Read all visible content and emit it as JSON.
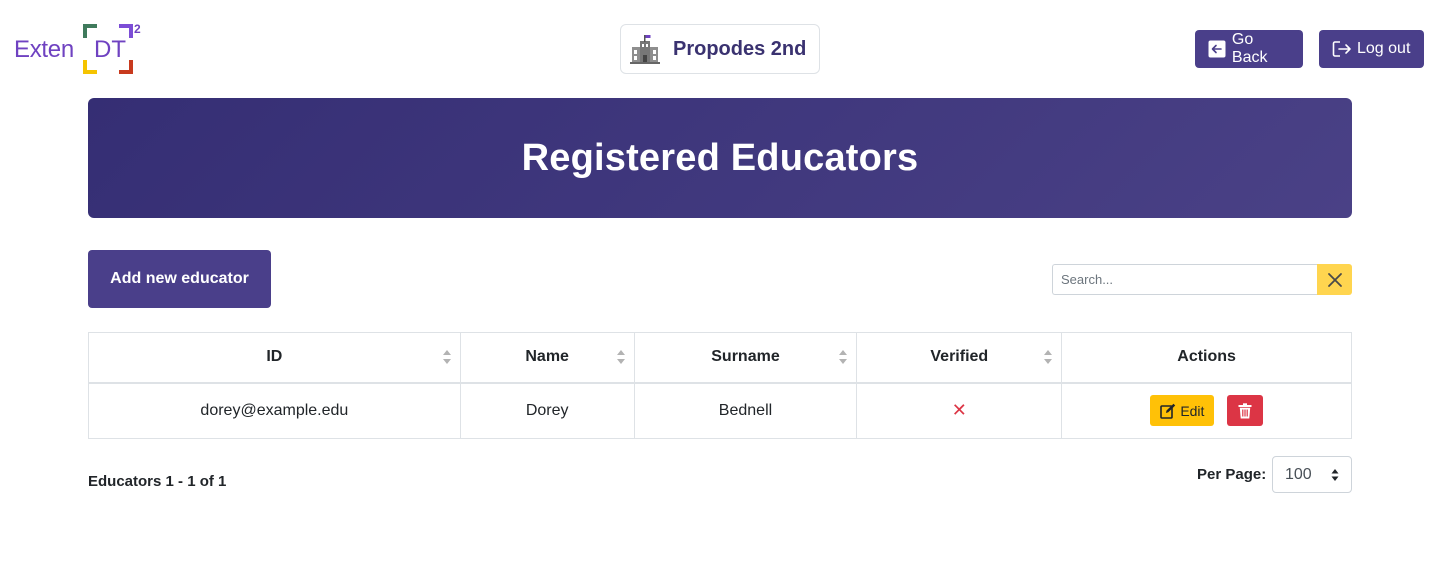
{
  "brand": {
    "logo_text": "Exten",
    "logo_dt": "DT",
    "logo_sup": "2",
    "colors": {
      "green": "#3f7a5c",
      "purple": "#7c4dd6",
      "yellow": "#f5c400",
      "red": "#c83a1e",
      "text": "#6f42c1"
    }
  },
  "school": {
    "name": "Propodes 2nd",
    "icon": "school-building-icon"
  },
  "header": {
    "go_back_label": "Go Back",
    "go_back_icon": "arrow-left-icon",
    "log_out_label": "Log out",
    "log_out_icon": "sign-out-icon"
  },
  "page": {
    "title": "Registered Educators"
  },
  "toolbar": {
    "add_label": "Add new educator",
    "search_placeholder": "Search...",
    "search_value": "",
    "clear_icon": "close-icon"
  },
  "table": {
    "columns": [
      {
        "label": "ID",
        "sortable": true
      },
      {
        "label": "Name",
        "sortable": true
      },
      {
        "label": "Surname",
        "sortable": true
      },
      {
        "label": "Verified",
        "sortable": true
      },
      {
        "label": "Actions",
        "sortable": false
      }
    ],
    "rows": [
      {
        "id": "dorey@example.edu",
        "name": "Dorey",
        "surname": "Bednell",
        "verified": "✕",
        "edit_label": "Edit"
      }
    ]
  },
  "footer": {
    "count_text": "Educators 1 - 1 of 1",
    "per_page_label": "Per Page:",
    "per_page_value": "100"
  },
  "accent_colors": {
    "primary": "#4a3f8a",
    "warning": "#ffc107",
    "danger": "#dc3545"
  }
}
